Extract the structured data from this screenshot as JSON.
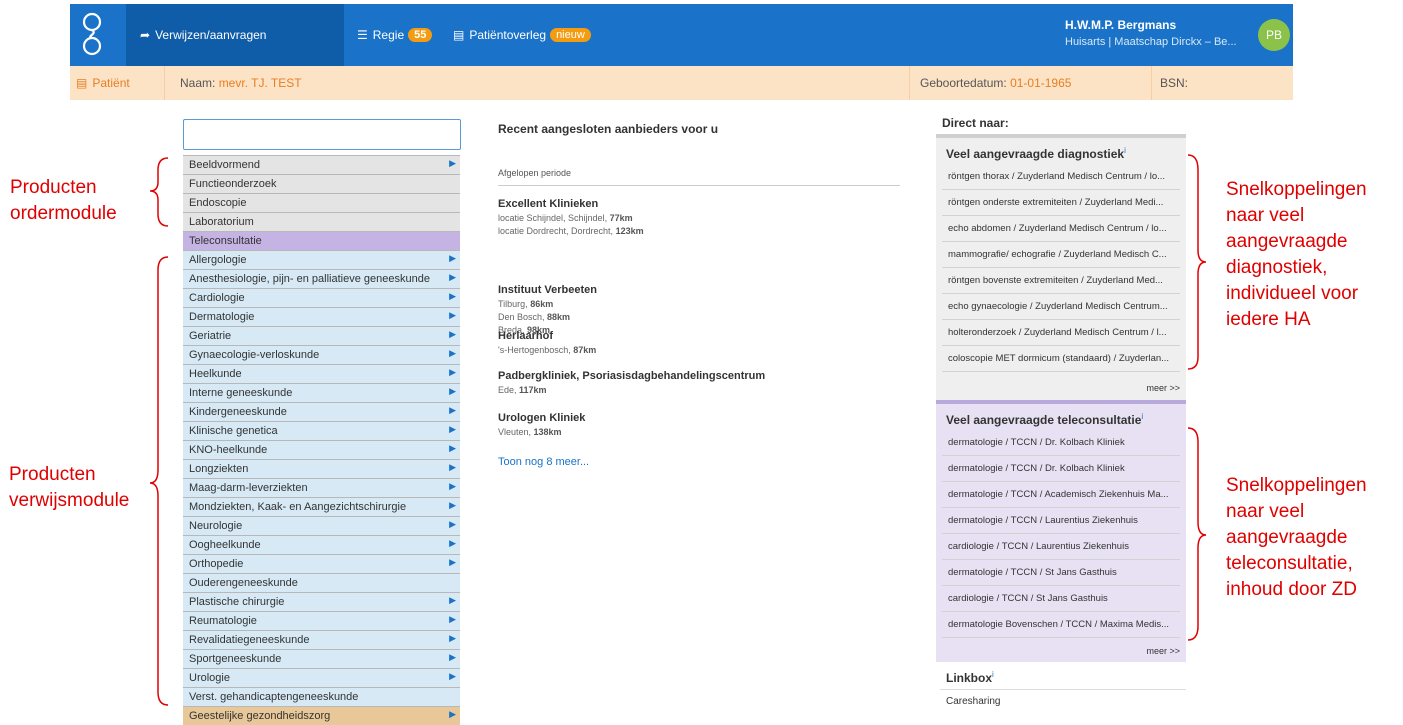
{
  "topbar": {
    "nav": [
      {
        "label": "Verwijzen/aanvragen",
        "icon": "share-arrow-icon"
      },
      {
        "label": "Regie",
        "icon": "list-icon",
        "badge": "55"
      },
      {
        "label": "Patiëntoverleg",
        "icon": "chat-icon",
        "badge": "nieuw"
      }
    ],
    "user_name": "H.W.M.P. Bergmans",
    "user_role": "Huisarts | Maatschap Dirckx – Be...",
    "avatar_initials": "PB"
  },
  "patient": {
    "tab": "Patiënt",
    "name_label": "Naam:",
    "name_value": "mevr. TJ. TEST",
    "dob_label": "Geboortedatum:",
    "dob_value": "01-01-1965",
    "bsn_label": "BSN:"
  },
  "orders": [
    {
      "label": "Beeldvormend",
      "color": "gray",
      "arrow": true
    },
    {
      "label": "Functieonderzoek",
      "color": "gray",
      "arrow": false
    },
    {
      "label": "Endoscopie",
      "color": "gray",
      "arrow": false
    },
    {
      "label": "Laboratorium",
      "color": "gray",
      "arrow": false
    },
    {
      "label": "Teleconsultatie",
      "color": "purple",
      "arrow": false
    }
  ],
  "referrals": [
    {
      "label": "Allergologie",
      "arrow": true
    },
    {
      "label": "Anesthesiologie, pijn- en palliatieve geneeskunde",
      "arrow": true
    },
    {
      "label": "Cardiologie",
      "arrow": true
    },
    {
      "label": "Dermatologie",
      "arrow": true
    },
    {
      "label": "Geriatrie",
      "arrow": true
    },
    {
      "label": "Gynaecologie-verloskunde",
      "arrow": true
    },
    {
      "label": "Heelkunde",
      "arrow": true
    },
    {
      "label": "Interne geneeskunde",
      "arrow": true
    },
    {
      "label": "Kindergeneeskunde",
      "arrow": true
    },
    {
      "label": "Klinische genetica",
      "arrow": true
    },
    {
      "label": "KNO-heelkunde",
      "arrow": true
    },
    {
      "label": "Longziekten",
      "arrow": true
    },
    {
      "label": "Maag-darm-leverziekten",
      "arrow": true
    },
    {
      "label": "Mondziekten, Kaak- en Aangezichtschirurgie",
      "arrow": true
    },
    {
      "label": "Neurologie",
      "arrow": true
    },
    {
      "label": "Oogheelkunde",
      "arrow": true
    },
    {
      "label": "Orthopedie",
      "arrow": true
    },
    {
      "label": "Ouderengeneeskunde",
      "arrow": false
    },
    {
      "label": "Plastische chirurgie",
      "arrow": true
    },
    {
      "label": "Reumatologie",
      "arrow": true
    },
    {
      "label": "Revalidatiegeneeskunde",
      "arrow": true
    },
    {
      "label": "Sportgeneeskunde",
      "arrow": true
    },
    {
      "label": "Urologie",
      "arrow": true
    },
    {
      "label": "Verst. gehandicaptengeneeskunde",
      "arrow": false
    }
  ],
  "extra_category": {
    "label": "Geestelijke gezondheidszorg",
    "arrow": true
  },
  "center": {
    "title": "Recent aangesloten aanbieders voor u",
    "period": "Afgelopen periode",
    "providers": [
      {
        "name": "Excellent Klinieken",
        "locations": [
          [
            "locatie Schijndel, Schijndel, ",
            "77km"
          ],
          [
            "locatie Dordrecht, Dordrecht, ",
            "123km"
          ]
        ]
      },
      {
        "name": "Instituut Verbeeten",
        "locations": [
          [
            "Tilburg, ",
            "86km"
          ],
          [
            "Den Bosch, ",
            "88km"
          ],
          [
            "Breda, ",
            "98km"
          ]
        ]
      },
      {
        "name": "Herlaarhof",
        "locations": [
          [
            "'s-Hertogenbosch, ",
            "87km"
          ]
        ]
      },
      {
        "name": "Padbergkliniek, Psoriasisdagbehandelingscentrum",
        "locations": [
          [
            "Ede, ",
            "117km"
          ]
        ]
      },
      {
        "name": "Urologen Kliniek",
        "locations": [
          [
            "Vleuten, ",
            "138km"
          ]
        ]
      }
    ],
    "more_link": "Toon nog 8 meer..."
  },
  "right": {
    "direct_label": "Direct naar:",
    "diag_title": "Veel aangevraagde diagnostiek",
    "diag_links": [
      "röntgen thorax / Zuyderland Medisch Centrum / lo...",
      "röntgen onderste extremiteiten / Zuyderland Medi...",
      "echo abdomen / Zuyderland Medisch Centrum / lo...",
      "mammografie/ echografie / Zuyderland Medisch C...",
      "röntgen bovenste extremiteiten / Zuyderland Med...",
      "echo gynaecologie / Zuyderland Medisch Centrum...",
      "holteronderzoek / Zuyderland Medisch Centrum / l...",
      "coloscopie MET dormicum (standaard) / Zuyderlan..."
    ],
    "tele_title": "Veel aangevraagde teleconsultatie",
    "tele_links": [
      "dermatologie / TCCN / Dr. Kolbach Kliniek",
      "dermatologie / TCCN / Dr. Kolbach Kliniek",
      "dermatologie / TCCN / Academisch Ziekenhuis Ma...",
      "dermatologie / TCCN / Laurentius Ziekenhuis",
      "cardiologie / TCCN / Laurentius Ziekenhuis",
      "dermatologie / TCCN / St Jans Gasthuis",
      "cardiologie / TCCN / St Jans Gasthuis",
      "dermatologie Bovenschen / TCCN / Maxima Medis..."
    ],
    "meer": "meer >>",
    "info_mark": "i",
    "linkbox_title": "Linkbox",
    "linkbox_item": "Caresharing"
  },
  "annotations": {
    "orders": [
      "Producten",
      "ordermodule"
    ],
    "referrals": [
      "Producten",
      "verwijsmodule"
    ],
    "diag": [
      "Snelkoppelingen",
      "naar veel",
      "aangevraagde",
      "diagnostiek,",
      "individueel voor",
      "iedere HA"
    ],
    "tele": [
      "Snelkoppelingen",
      "naar veel",
      "aangevraagde",
      "teleconsultatie,",
      "inhoud door ZD"
    ]
  },
  "colors": {
    "topbar": "#1a73c8",
    "topbar_active": "#0f5ca8",
    "patient_bar": "#fde3c6",
    "badge": "#f39c12",
    "accent_orange": "#e67e22",
    "annotation_red": "#e00000",
    "referral_blue": "#d6e9f5",
    "order_gray": "#e4e4e4",
    "tele_purple": "#c5b4e3"
  }
}
